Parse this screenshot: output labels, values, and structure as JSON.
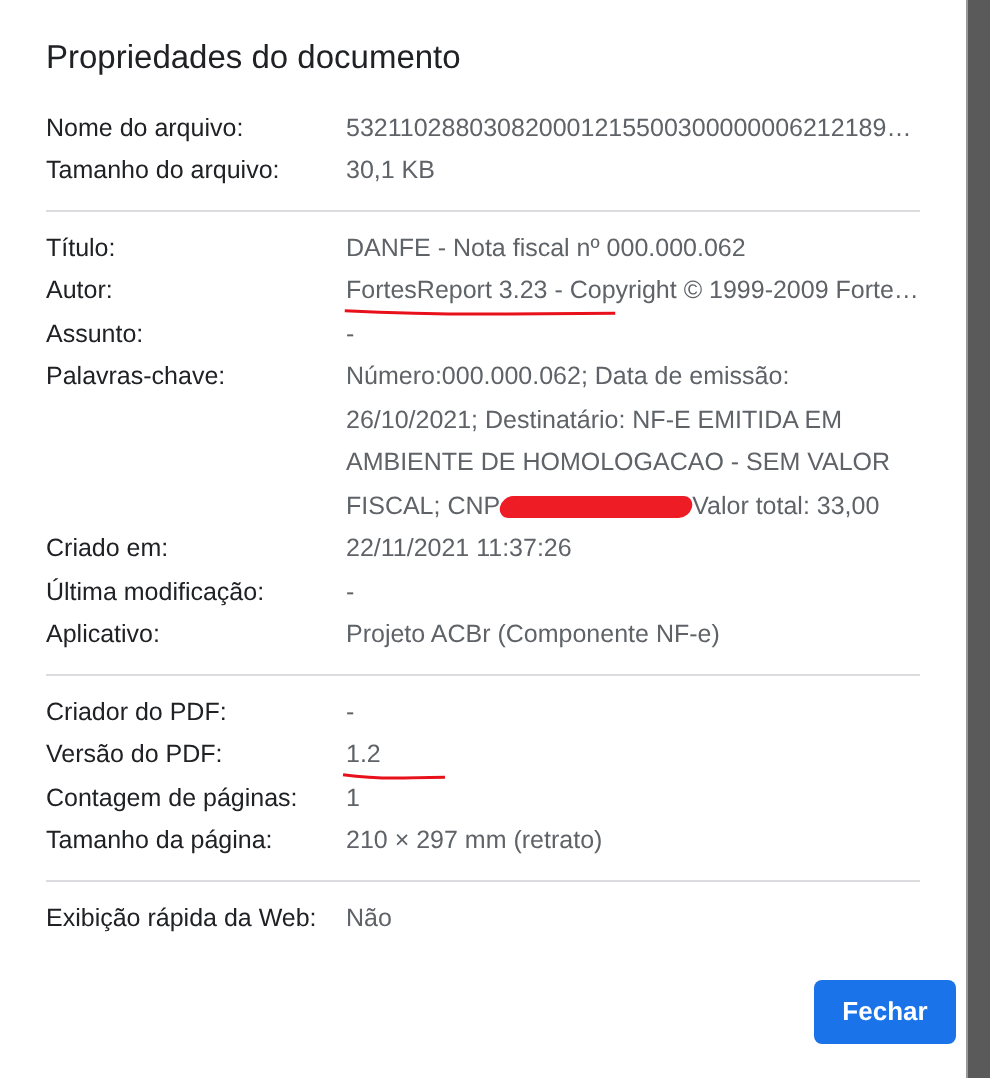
{
  "dialog": {
    "title": "Propriedades do documento"
  },
  "sections": [
    {
      "rows": [
        {
          "label": "Nome do arquivo:",
          "value": "532110288030820001215500300000006212189…",
          "underlined": false
        },
        {
          "label": "Tamanho do arquivo:",
          "value": "30,1 KB",
          "underlined": false
        }
      ]
    },
    {
      "rows": [
        {
          "label": "Título:",
          "value": "DANFE - Nota fiscal nº 000.000.062",
          "underlined": false
        },
        {
          "label": "Autor:",
          "value": "FortesReport 3.23 - Copyright © 1999-2009 Forte…",
          "underlined": true
        },
        {
          "label": "Assunto:",
          "value": "-",
          "underlined": false
        },
        {
          "label": "Palavras-chave:",
          "kind": "redacted",
          "value_lines": [
            "Número:000.000.062; Data de emissão:",
            "26/10/2021; Destinatário: NF-E EMITIDA EM",
            "AMBIENTE DE HOMOLOGACAO - SEM VALOR",
            "FISCAL; CNP"
          ],
          "value_after": "Valor total: 33,00",
          "underlined": false
        },
        {
          "label": "Criado em:",
          "value": "22/11/2021 11:37:26",
          "underlined": false
        },
        {
          "label": "Última modificação:",
          "value": "-",
          "underlined": false
        },
        {
          "label": "Aplicativo:",
          "value": "Projeto ACBr (Componente NF-e)",
          "underlined": false
        }
      ]
    },
    {
      "rows": [
        {
          "label": "Criador do PDF:",
          "value": "-",
          "underlined": false
        },
        {
          "label": "Versão do PDF:",
          "value": "1.2",
          "underlined": true
        },
        {
          "label": "Contagem de páginas:",
          "value": "1",
          "underlined": false
        },
        {
          "label": "Tamanho da página:",
          "value": "210 × 297 mm (retrato)",
          "underlined": false
        }
      ]
    },
    {
      "rows": [
        {
          "label": "Exibição rápida da Web:",
          "value": "Não",
          "underlined": false
        }
      ]
    }
  ],
  "buttons": [
    {
      "label": "Fechar"
    }
  ]
}
